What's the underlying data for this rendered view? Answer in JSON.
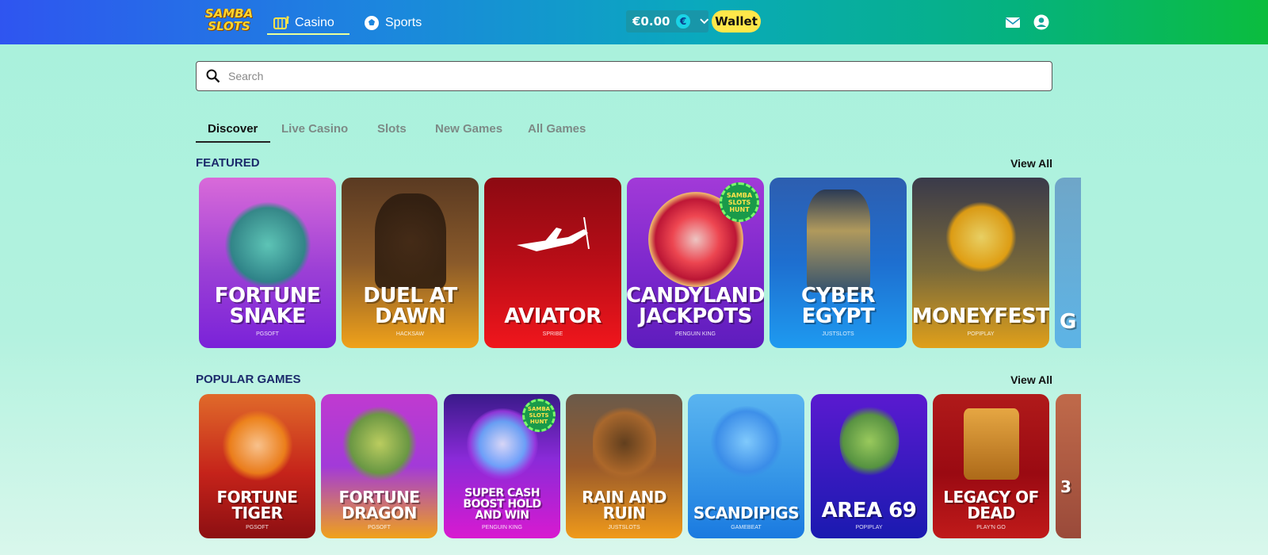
{
  "header": {
    "logo_text": "SAMBA SLOTS",
    "tabs": [
      {
        "label": "Casino",
        "icon": "casino-icon",
        "active": true
      },
      {
        "label": "Sports",
        "icon": "sports-icon",
        "active": false
      }
    ],
    "balance": "€0.00",
    "currency_symbol": "€",
    "wallet_label": "Wallet",
    "colors": {
      "accent": "#ffe74a",
      "brand_start": "#2f55f0",
      "brand_end": "#0bbd3e"
    }
  },
  "search": {
    "placeholder": "Search",
    "value": ""
  },
  "categories": [
    {
      "label": "Discover",
      "active": true
    },
    {
      "label": "Live Casino",
      "active": false
    },
    {
      "label": "Slots",
      "active": false
    },
    {
      "label": "New Games",
      "active": false
    },
    {
      "label": "All Games",
      "active": false
    }
  ],
  "sections": {
    "featured": {
      "title": "FEATURED",
      "view_all": "View All",
      "games": [
        {
          "title": "FORTUNE SNAKE",
          "provider": "PGSOFT"
        },
        {
          "title": "DUEL AT DAWN",
          "provider": "HACKSAW"
        },
        {
          "title": "AVIATOR",
          "provider": "SPRIBE"
        },
        {
          "title": "CANDYLAND JACKPOTS",
          "provider": "PENGUIN KING",
          "badge": "SAMBA SLOTS HUNT"
        },
        {
          "title": "CYBER EGYPT",
          "provider": "JUSTSLOTS"
        },
        {
          "title": "MONEYFEST",
          "provider": "POPIPLAY"
        },
        {
          "title": "G DE",
          "provider": ""
        }
      ]
    },
    "popular": {
      "title": "POPULAR GAMES",
      "view_all": "View All",
      "games": [
        {
          "title": "FORTUNE TIGER",
          "provider": "PGSOFT"
        },
        {
          "title": "FORTUNE DRAGON",
          "provider": "PGSOFT"
        },
        {
          "title": "SUPER CASH BOOST HOLD AND WIN",
          "provider": "PENGUIN KING",
          "badge": "SAMBA SLOTS HUNT"
        },
        {
          "title": "RAIN AND RUIN",
          "provider": "JUSTSLOTS"
        },
        {
          "title": "SCANDIPIGS",
          "provider": "GAMEBEAT"
        },
        {
          "title": "AREA 69",
          "provider": "POPIPLAY"
        },
        {
          "title": "LEGACY OF DEAD",
          "provider": "PLAY'N GO"
        },
        {
          "title": "3",
          "provider": ""
        }
      ]
    }
  }
}
